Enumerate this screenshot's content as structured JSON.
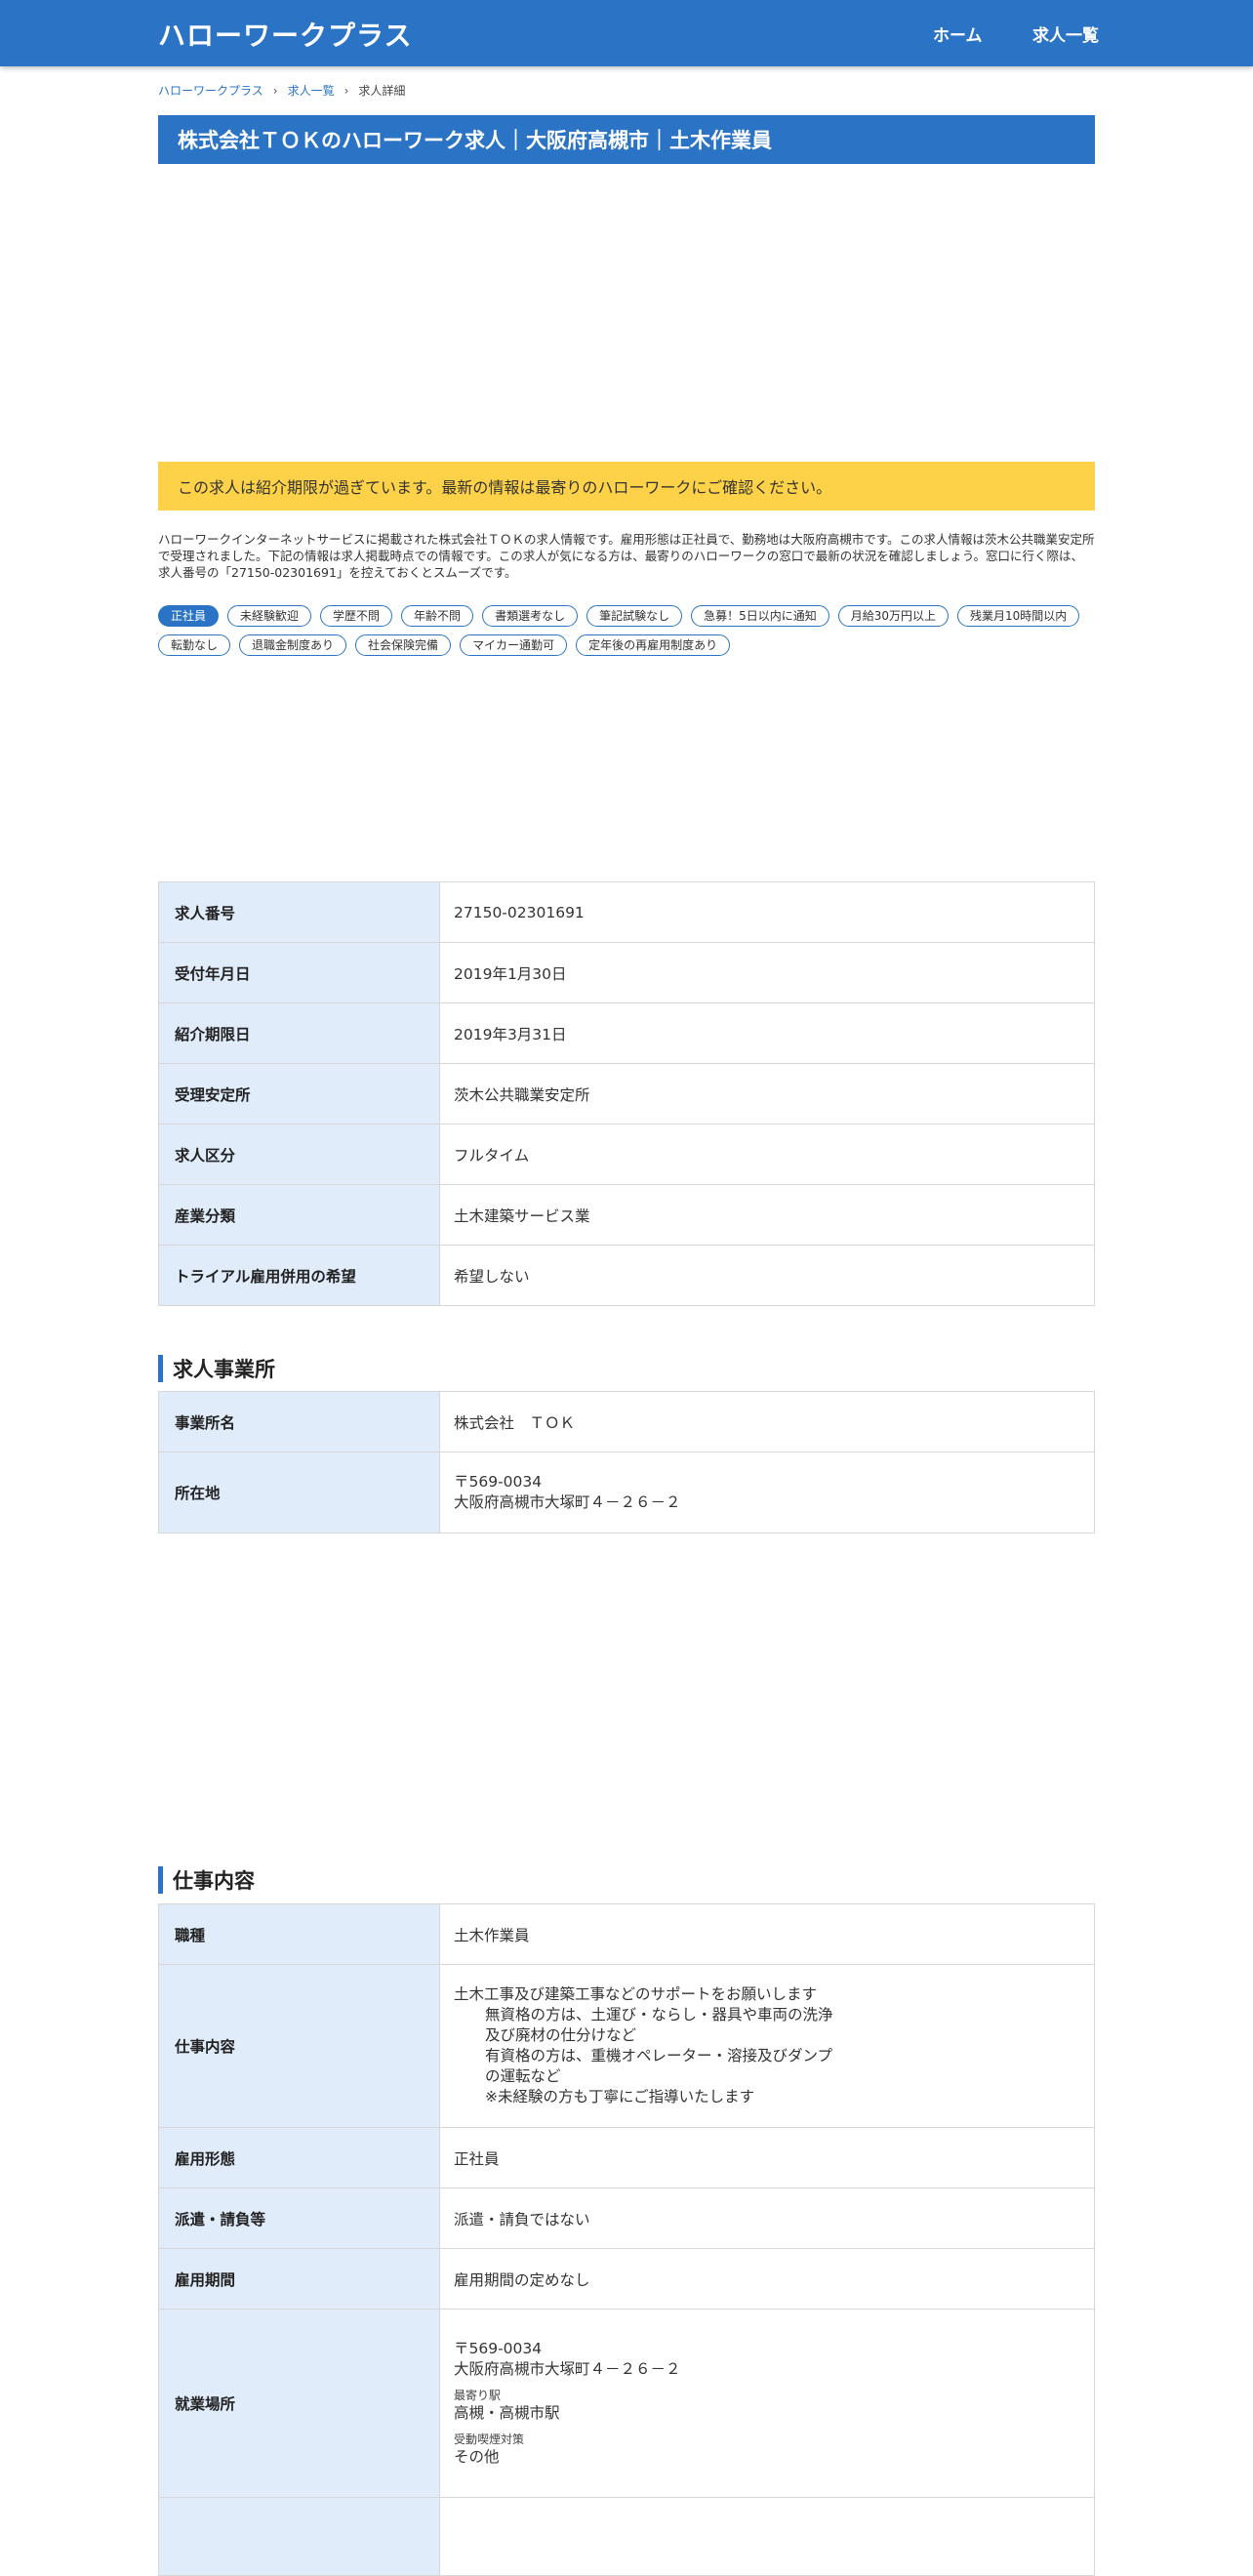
{
  "header": {
    "brand": "ハローワークプラス",
    "nav": [
      {
        "label": "ホーム"
      },
      {
        "label": "求人一覧"
      }
    ]
  },
  "breadcrumb": {
    "items": [
      "ハローワークプラス",
      "求人一覧"
    ],
    "current": "求人詳細"
  },
  "title": "株式会社ＴＯＫのハローワーク求人｜大阪府高槻市｜土木作業員",
  "notice": "この求人は紹介期限が過ぎています。最新の情報は最寄りのハローワークにご確認ください。",
  "intro": "ハローワークインターネットサービスに掲載された株式会社ＴＯＫの求人情報です。雇用形態は正社員で、勤務地は大阪府高槻市です。この求人情報は茨木公共職業安定所で受理されました。下記の情報は求人掲載時点での情報です。この求人が気になる方は、最寄りのハローワークの窓口で最新の状況を確認しましょう。窓口に行く際は、求人番号の「27150-02301691」を控えておくとスムーズです。",
  "tags": [
    {
      "label": "正社員",
      "active": true
    },
    {
      "label": "未経験歓迎",
      "active": false
    },
    {
      "label": "学歴不問",
      "active": false
    },
    {
      "label": "年齢不問",
      "active": false
    },
    {
      "label": "書類選考なし",
      "active": false
    },
    {
      "label": "筆記試験なし",
      "active": false
    },
    {
      "label": "急募！5日以内に通知",
      "active": false
    },
    {
      "label": "月給30万円以上",
      "active": false
    },
    {
      "label": "残業月10時間以内",
      "active": false
    },
    {
      "label": "転勤なし",
      "active": false
    },
    {
      "label": "退職金制度あり",
      "active": false
    },
    {
      "label": "社会保険完備",
      "active": false
    },
    {
      "label": "マイカー通勤可",
      "active": false
    },
    {
      "label": "定年後の再雇用制度あり",
      "active": false
    }
  ],
  "job_info": [
    {
      "label": "求人番号",
      "value": "27150-02301691"
    },
    {
      "label": "受付年月日",
      "value": "2019年1月30日"
    },
    {
      "label": "紹介期限日",
      "value": "2019年3月31日"
    },
    {
      "label": "受理安定所",
      "value": "茨木公共職業安定所"
    },
    {
      "label": "求人区分",
      "value": "フルタイム"
    },
    {
      "label": "産業分類",
      "value": "土木建築サービス業"
    },
    {
      "label": "トライアル雇用併用の希望",
      "value": "希望しない"
    }
  ],
  "office_section": {
    "heading": "求人事業所",
    "name_label": "事業所名",
    "name_value": "株式会社　ＴＯＫ",
    "address_label": "所在地",
    "postal": "〒569-0034",
    "address": "大阪府高槻市大塚町４－２６－２"
  },
  "work_section": {
    "heading": "仕事内容",
    "occupation_label": "職種",
    "occupation_value": "土木作業員",
    "description_label": "仕事内容",
    "description_lines": [
      "土木工事及び建築工事などのサポートをお願いします",
      "無資格の方は、土運び・ならし・器具や車両の洗浄",
      "及び廃材の仕分けなど",
      "有資格の方は、重機オペレーター・溶接及びダンプ",
      "の運転など",
      "※未経験の方も丁寧にご指導いたします"
    ],
    "employment_label": "雇用形態",
    "employment_value": "正社員",
    "dispatch_label": "派遣・請負等",
    "dispatch_value": "派遣・請負ではない",
    "period_label": "雇用期間",
    "period_value": "雇用期間の定めなし",
    "place_label": "就業場所",
    "place_postal": "〒569-0034",
    "place_address": "大阪府高槻市大塚町４－２６－２",
    "station_label": "最寄り駅",
    "station_value": "高槻・高槻市駅",
    "smoking_label": "受動喫煙対策",
    "smoking_value": "その他"
  }
}
